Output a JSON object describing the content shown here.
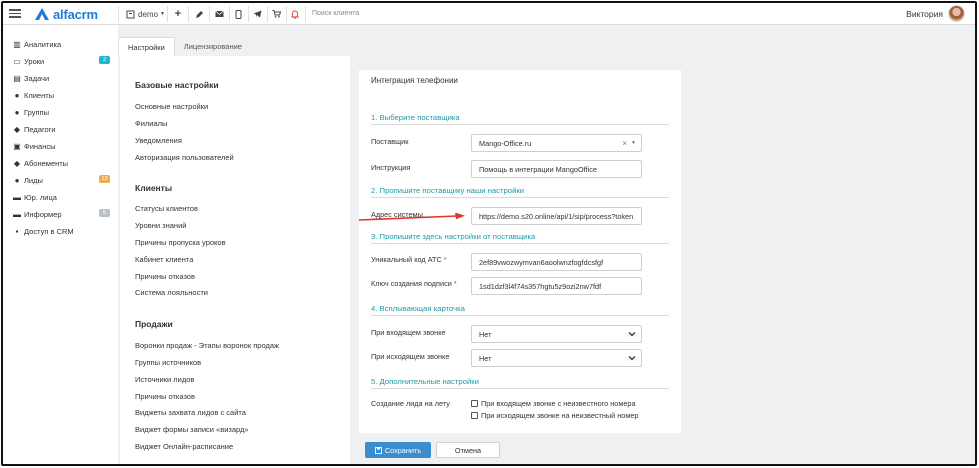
{
  "topbar": {
    "logo_text": "alfacrm",
    "branch": "demo",
    "search_placeholder": "Поиск клиента",
    "user_name": "Виктория",
    "icons": [
      "menu-icon",
      "plus-icon",
      "pencil-icon",
      "envelope-icon",
      "mobile-icon",
      "telegram-icon",
      "cart-icon",
      "bell-icon"
    ]
  },
  "sidebar": {
    "items": [
      {
        "label": "Аналитика",
        "icon": "chart-icon"
      },
      {
        "label": "Уроки",
        "icon": "calendar-icon",
        "badge": "2",
        "badge_color": "#20b8c8"
      },
      {
        "label": "Задачи",
        "icon": "tasks-icon"
      },
      {
        "label": "Клиенты",
        "icon": "user-icon"
      },
      {
        "label": "Группы",
        "icon": "users-icon"
      },
      {
        "label": "Педагоги",
        "icon": "graduation-icon"
      },
      {
        "label": "Финансы",
        "icon": "money-icon"
      },
      {
        "label": "Абонементы",
        "icon": "tag-icon"
      },
      {
        "label": "Лиды",
        "icon": "user-plus-icon",
        "badge": "13",
        "badge_color": "#f0ad4e"
      },
      {
        "label": "Юр. лица",
        "icon": "briefcase-icon"
      },
      {
        "label": "Информер",
        "icon": "envelope-icon",
        "badge": "5",
        "badge_color": "#b9c1c8"
      },
      {
        "label": "Доступ в CRM",
        "icon": "lock-icon"
      }
    ]
  },
  "tabs": [
    {
      "label": "Настройки",
      "active": true
    },
    {
      "label": "Лицензирование",
      "active": false
    }
  ],
  "left": {
    "base_title": "Базовые настройки",
    "base_links": [
      "Основные настройки",
      "Филиалы",
      "Уведомления",
      "Авторизация пользователей"
    ],
    "clients_title": "Клиенты",
    "clients_links": [
      "Статусы клиентов",
      "Уровни знаний",
      "Причины пропуска уроков",
      "Кабинет клиента",
      "Причины отказов",
      "Система лояльности"
    ],
    "sales_title": "Продажи",
    "sales_links": [
      "Воронки продаж - Этапы воронок продаж",
      "Группы источников",
      "Источники лидов",
      "Причины отказов",
      "Виджеты захвата лидов с сайта",
      "Виджет формы записи «визард»",
      "Виджет Онлайн-расписание"
    ]
  },
  "right": {
    "title": "Интеграция телефонии",
    "step1": "1. Выберите поставщика",
    "provider_label": "Поставщик",
    "provider_value": "Mango-Office.ru",
    "instruction_label": "Инструкция",
    "instruction_value": "Помощь в интеграции MangoOffice",
    "step2": "2. Пропишите поставщику наши настройки",
    "address_label": "Адрес системы",
    "address_value": "https://demo.s20.online/api/1/sip/process?token",
    "step3": "3. Пропишите здесь настройки от поставщика",
    "ats_label": "Уникальный код АТС",
    "ats_value": "2ef89vwozwymvan6aoolwnzfogfdcsfgf",
    "sign_label": "Ключ создания подписи",
    "sign_value": "1sd1dzf3l4f74s357hgtu5z9ozi2nw7fdf",
    "step4": "4. Всплывающая карточка",
    "incoming_label": "При входящем звонке",
    "incoming_value": "Нет",
    "outgoing_label": "При исходящем звонке",
    "outgoing_value": "Нет",
    "step5": "5. Дополнительные настройки",
    "lead_label": "Создание лида на лету",
    "chk1": "При входящем звонке с неизвестного номера",
    "chk2": "При исходящем звонке на неизвестный номер",
    "required_mark": "*"
  },
  "buttons": {
    "save": "Сохранить",
    "cancel": "Отмена"
  },
  "colors": {
    "accent": "#1e7bd6",
    "step": "#1f9aa5",
    "save": "#3c8dcd",
    "arrow": "#e0342a"
  }
}
